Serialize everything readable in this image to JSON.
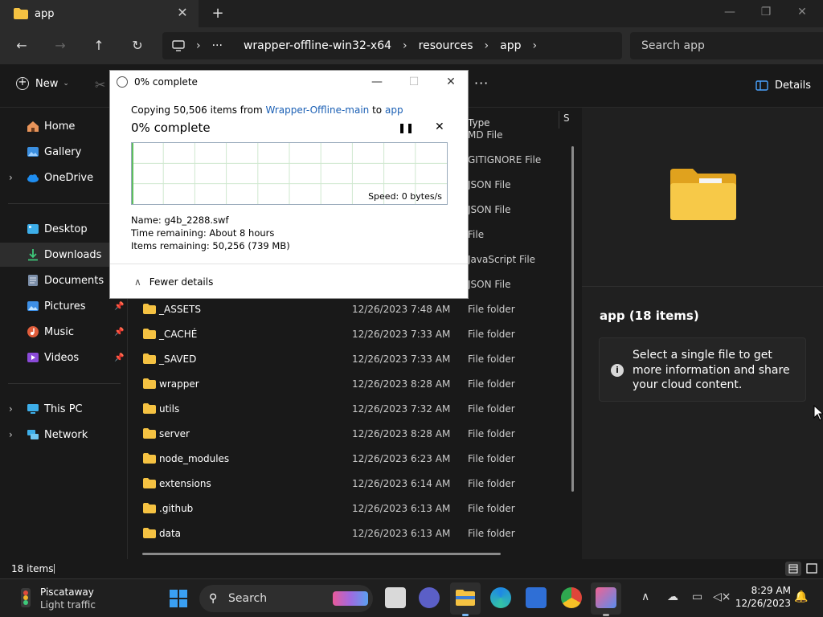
{
  "window": {
    "tab_title": "app",
    "min_icon": "minimize-icon",
    "max_icon": "maximize-icon",
    "close_icon": "close-icon"
  },
  "address": {
    "crumbs": [
      "wrapper-offline-win32-x64",
      "resources",
      "app"
    ],
    "ellipsis": "···",
    "search_placeholder": "Search app"
  },
  "toolbar": {
    "new_label": "New",
    "more_label": "···",
    "details_label": "Details"
  },
  "sidebar": {
    "items": [
      {
        "label": "Home"
      },
      {
        "label": "Gallery"
      },
      {
        "label": "OneDrive"
      },
      {
        "label": "Desktop"
      },
      {
        "label": "Downloads"
      },
      {
        "label": "Documents"
      },
      {
        "label": "Pictures"
      },
      {
        "label": "Music"
      },
      {
        "label": "Videos"
      },
      {
        "label": "This PC"
      },
      {
        "label": "Network"
      }
    ]
  },
  "filelist": {
    "type_header": "Type",
    "size_header_fragment": "S",
    "partial_types": [
      "MD File",
      "GITIGNORE File",
      "JSON File",
      "JSON File",
      "File",
      "JavaScript File",
      "JSON File"
    ],
    "rows": [
      {
        "name": "_ASSETS",
        "date": "12/26/2023 7:48 AM",
        "type": "File folder"
      },
      {
        "name": "_CACHÉ",
        "date": "12/26/2023 7:33 AM",
        "type": "File folder"
      },
      {
        "name": "_SAVED",
        "date": "12/26/2023 7:33 AM",
        "type": "File folder"
      },
      {
        "name": "wrapper",
        "date": "12/26/2023 8:28 AM",
        "type": "File folder"
      },
      {
        "name": "utils",
        "date": "12/26/2023 7:32 AM",
        "type": "File folder"
      },
      {
        "name": "server",
        "date": "12/26/2023 8:28 AM",
        "type": "File folder"
      },
      {
        "name": "node_modules",
        "date": "12/26/2023 6:23 AM",
        "type": "File folder"
      },
      {
        "name": "extensions",
        "date": "12/26/2023 6:14 AM",
        "type": "File folder"
      },
      {
        "name": ".github",
        "date": "12/26/2023 6:13 AM",
        "type": "File folder"
      },
      {
        "name": "data",
        "date": "12/26/2023 6:13 AM",
        "type": "File folder"
      }
    ]
  },
  "details": {
    "title": "app (18 items)",
    "info": "Select a single file to get more information and share your cloud content."
  },
  "status": {
    "count": "18 items"
  },
  "dialog": {
    "title": "0% complete",
    "copy_prefix": "Copying 50,506 items from ",
    "source": "Wrapper-Offline-main",
    "to_word": " to ",
    "dest": "app",
    "percent": "0% complete",
    "progress_percent": 0,
    "speed": "Speed: 0 bytes/s",
    "name_line": "Name:  g4b_2288.swf",
    "time_line": "Time remaining:  About 8 hours",
    "items_line": "Items remaining:  50,256 (739 MB)",
    "fewer": "Fewer details"
  },
  "taskbar": {
    "weather_city": "Piscataway",
    "weather_status": "Light traffic",
    "search_label": "Search",
    "time": "8:29 AM",
    "date": "12/26/2023"
  },
  "colors": {
    "folder_yellow": "#f5c242",
    "accent_blue": "#1a5fb4",
    "graph_green": "#5fbf5f"
  }
}
